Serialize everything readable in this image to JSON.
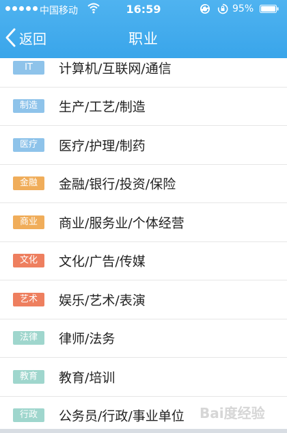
{
  "status_bar": {
    "carrier": "中国移动",
    "time": "16:59",
    "battery": "95%"
  },
  "nav": {
    "back_label": "返回",
    "title": "职业"
  },
  "colors": {
    "header": "#3aa6ea",
    "tag_blue": "#8ec3ea",
    "tag_orange": "#f0ad5a",
    "tag_red": "#ee7f5f",
    "tag_teal": "#9fd6cd"
  },
  "items": [
    {
      "tag": "IT",
      "label": "计算机/互联网/通信",
      "color": "#8ec3ea"
    },
    {
      "tag": "制造",
      "label": "生产/工艺/制造",
      "color": "#8ec3ea"
    },
    {
      "tag": "医疗",
      "label": "医疗/护理/制药",
      "color": "#8ec3ea"
    },
    {
      "tag": "金融",
      "label": "金融/银行/投资/保险",
      "color": "#f0ad5a"
    },
    {
      "tag": "商业",
      "label": "商业/服务业/个体经营",
      "color": "#f0ad5a"
    },
    {
      "tag": "文化",
      "label": "文化/广告/传媒",
      "color": "#ee7f5f"
    },
    {
      "tag": "艺术",
      "label": "娱乐/艺术/表演",
      "color": "#ee7f5f"
    },
    {
      "tag": "法律",
      "label": "律师/法务",
      "color": "#9fd6cd"
    },
    {
      "tag": "教育",
      "label": "教育/培训",
      "color": "#9fd6cd"
    },
    {
      "tag": "行政",
      "label": "公务员/行政/事业单位",
      "color": "#9fd6cd"
    }
  ],
  "watermark": "Bai度经验"
}
